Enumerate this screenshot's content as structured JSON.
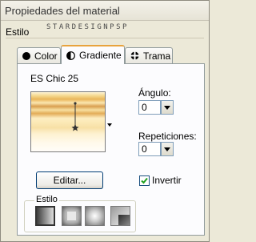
{
  "window": {
    "title": "Propiedades del material"
  },
  "group": {
    "label": "Estilo"
  },
  "watermark": {
    "text": "STARDESIGNPSP"
  },
  "tabs": [
    {
      "label": "Color",
      "icon": "circle-icon",
      "selected": false
    },
    {
      "label": "Gradiente",
      "icon": "half-circle-icon",
      "selected": true
    },
    {
      "label": "Trama",
      "icon": "pattern-icon",
      "selected": false
    }
  ],
  "gradient": {
    "name": "ES Chic 25",
    "colors": [
      "#fdf3d6",
      "#e9b55a",
      "#d9a050",
      "#fbe8b4",
      "#fffdf8"
    ]
  },
  "angle": {
    "label": "Ángulo:",
    "value": "0"
  },
  "repetitions": {
    "label": "Repeticiones:",
    "value": "0"
  },
  "edit_button": {
    "label": "Editar..."
  },
  "invert": {
    "label": "Invertir",
    "checked": true
  },
  "style_group": {
    "label": "Estilo",
    "options": [
      "linear-gradient-icon",
      "rectangular-gradient-icon",
      "sunburst-gradient-icon",
      "radial-gradient-icon"
    ],
    "selected_index": 0
  },
  "colors": {
    "dialog_bg": "#ece9d8",
    "panel_bg": "#fcfcfe",
    "tab_accent": "#e8a33d",
    "input_border": "#7f9db9"
  }
}
